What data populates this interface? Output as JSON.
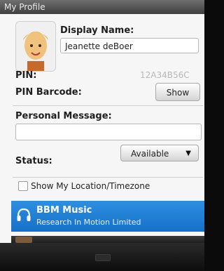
{
  "window": {
    "title": "My Profile"
  },
  "profile": {
    "display_name_label": "Display Name:",
    "display_name_value": "Jeanette deBoer",
    "pin_label": "PIN:",
    "pin_value": "12A34B56C",
    "pin_barcode_label": "PIN Barcode:",
    "show_button_label": "Show",
    "personal_message_label": "Personal Message:",
    "personal_message_value": "",
    "status_label": "Status:",
    "status_value": "Available",
    "location_checkbox_label": "Show My Location/Timezone",
    "location_checked": false
  },
  "list": {
    "items": [
      {
        "title": "BBM Music",
        "subtitle": "Research In Motion Limited",
        "icon": "headphones-icon"
      }
    ]
  },
  "colors": {
    "selection_blue": "#1f7fd6",
    "titlebar": "#4a4a4a",
    "background": "#f6f6f6"
  }
}
